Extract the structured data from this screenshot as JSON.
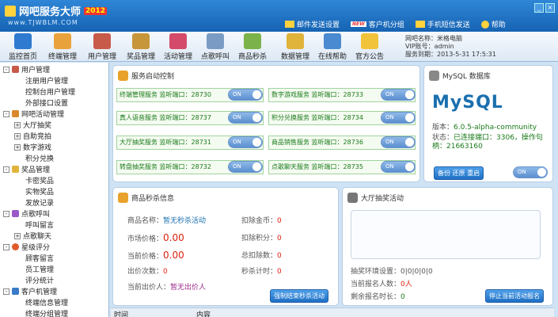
{
  "app": {
    "title": "网吧服务大师",
    "version": "2012",
    "site": "www.TJWBLM.COM"
  },
  "toplinks": [
    "邮件发送设置",
    "客户机分组",
    "手机短信发送",
    "帮助"
  ],
  "toolbar": [
    "监控首页",
    "终端管理",
    "用户管理",
    "奖品管理",
    "活动管理",
    "点歌呼叫",
    "商品秒杀",
    "数据管理",
    "在线帮助",
    "官方公告"
  ],
  "userinfo": {
    "name_label": "网吧名称：",
    "name": "米格电脑",
    "vip_label": "VIP账号：",
    "vip": "admin",
    "exp_label": "服务到期：",
    "exp": "2013-5-31 17:5:31"
  },
  "sidebar": {
    "nodes": [
      "用户管理",
      "注册用户管理",
      "控制台用户管理",
      "外部接口设置",
      "网吧活动管理",
      "大厅抽奖",
      "自助竞拍",
      "数字游戏",
      "积分兑换",
      "奖品管理",
      "卡密奖品",
      "实物奖品",
      "发放记录",
      "点歌呼叫",
      "呼叫留言",
      "点歌聊天",
      "星级评分",
      "顾客留言",
      "员工管理",
      "评分统计",
      "客户机管理",
      "终端信息管理",
      "终端分组管理"
    ]
  },
  "services": {
    "title": "服务启动控制",
    "items": [
      "终端管理服务  监听端口：28730",
      "数字游戏服务  监听端口：28733",
      "真人语音服务  监听端口：28737",
      "积分兑换服务  监听端口：28734",
      "大厅抽奖服务  监听端口：28731",
      "商品销售服务  监听端口：28736",
      "转盘抽奖服务  监听端口：28732",
      "点歌聊天服务  监听端口：28735"
    ],
    "on": "ON"
  },
  "mysql": {
    "title": "MySQL 数据库",
    "logo": "MySQL",
    "ver_label": "版本：",
    "version": "6.0.5-alpha-community",
    "state_label": "状态：",
    "state": "已连接端口：3306，操作句柄：21663160",
    "action": "备份  还原  重启",
    "on": "ON"
  },
  "flash": {
    "title": "商品秒杀信息",
    "name_label": "商品名称：",
    "name": "暂无秒杀活动",
    "coin_label": "扣除金币：",
    "coin": "0",
    "market_label": "市场价格：",
    "market": "0.00",
    "points_label": "扣除积分：",
    "points": "0",
    "cur_label": "当前价格：",
    "cur": "0.00",
    "total_label": "总扣除数：",
    "total": "0",
    "bids_label": "出价次数：",
    "bids": "0",
    "timer_label": "秒杀计时：",
    "timer": "0",
    "bidder_label": "当前出价人：",
    "bidder": "暂无出价人",
    "stop": "强制结束秒杀活动"
  },
  "lottery": {
    "title": "大厅抽奖活动",
    "settings_label": "抽奖环境设置：",
    "settings": "0|0|0|0|0",
    "count_label": "当前报名人数：",
    "count": "0人",
    "left_label": "剩余报名时长：",
    "left": "0",
    "stop": "停止当前活动报名"
  },
  "grid": {
    "col_time": "时间",
    "col_content": "内容"
  }
}
